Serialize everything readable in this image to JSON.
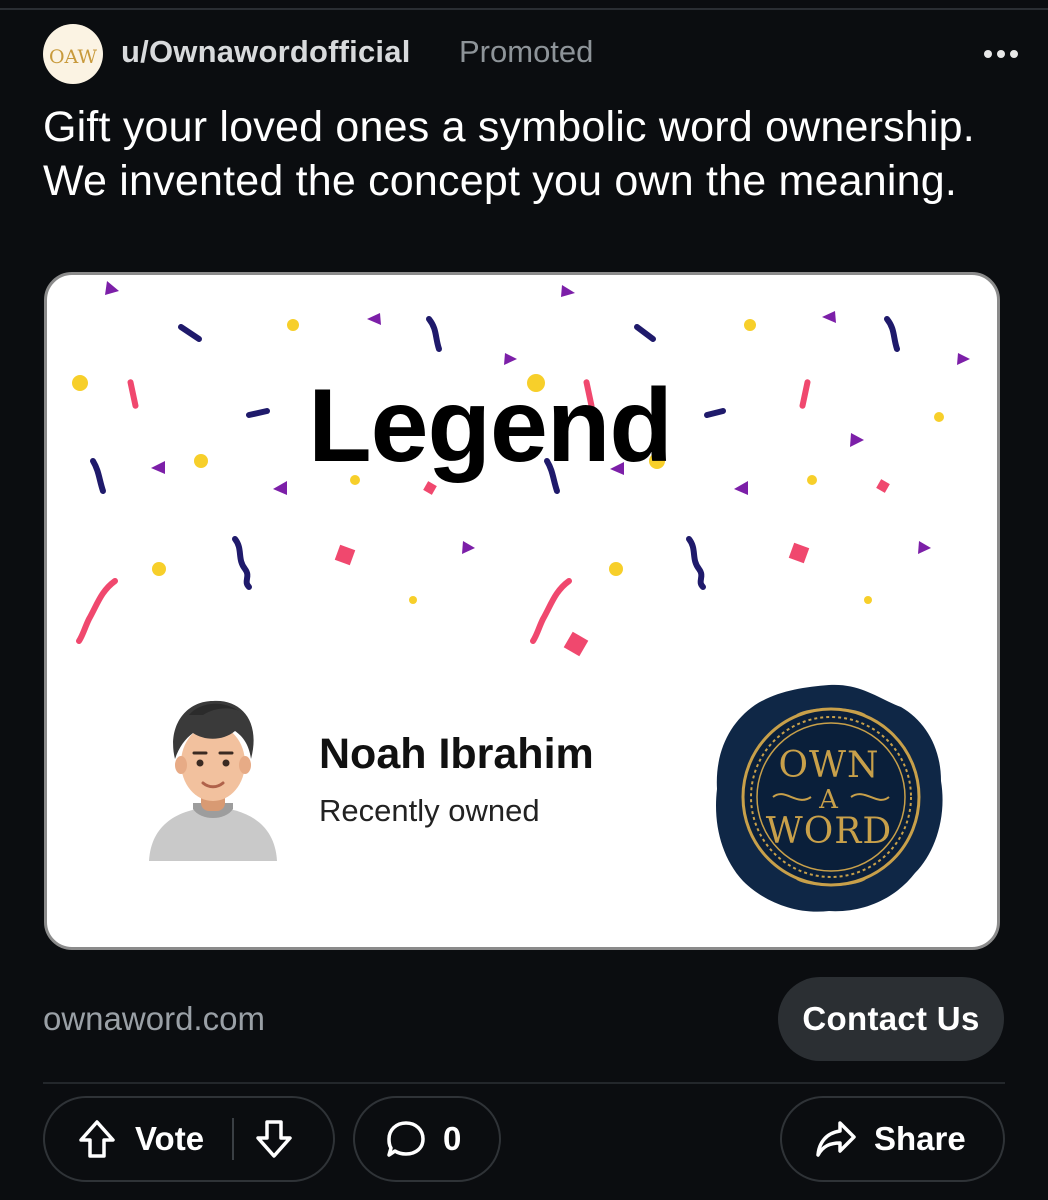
{
  "post": {
    "username": "u/Ownawordofficial",
    "promoted_label": "Promoted",
    "title": "Gift your loved ones a symbolic word ownership. We invented the concept you own the meaning.",
    "avatar_logo_text": "OAW",
    "card": {
      "word": "Legend",
      "owner_name": "Noah Ibrahim",
      "owner_status": "Recently owned",
      "seal": {
        "line1": "OWN",
        "line2": "A",
        "line3": "WORD"
      }
    },
    "domain": "ownaword.com",
    "cta_label": "Contact Us",
    "actions": {
      "vote_label": "Vote",
      "comment_count": "0",
      "share_label": "Share"
    }
  },
  "icons": {
    "more": "more-dots-icon",
    "upvote": "arrow-up-icon",
    "downvote": "arrow-down-icon",
    "comment": "comment-bubble-icon",
    "share": "share-arrow-icon"
  },
  "colors": {
    "background": "#0b0d10",
    "card_background": "#ffffff",
    "button_background": "#2b2f33",
    "confetti_navy": "#1f1a6b",
    "confetti_pink": "#f0486e",
    "confetti_yellow": "#f7cf2a",
    "confetti_purple": "#7c1fa8",
    "seal_navy": "#0f2746",
    "seal_gold": "#c8a04a"
  }
}
